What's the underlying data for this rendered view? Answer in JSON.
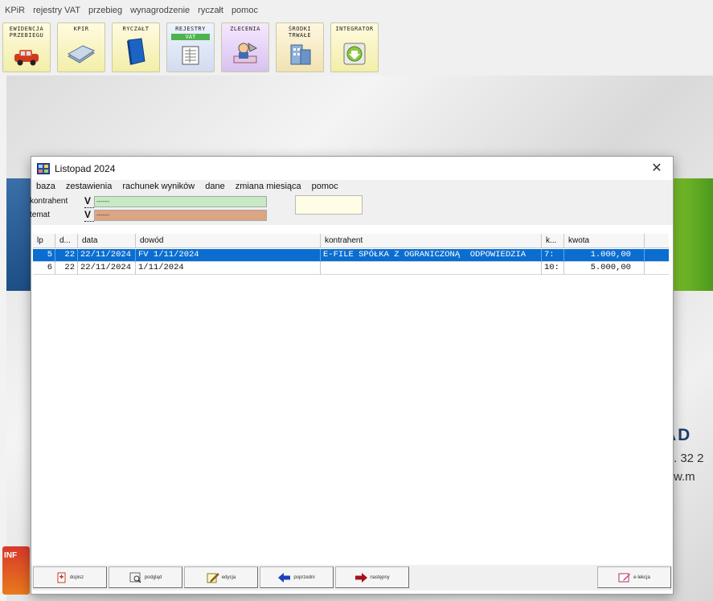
{
  "app_menu": [
    "KPiR",
    "rejestry VAT",
    "przebieg",
    "wynagrodzenie",
    "ryczałt",
    "pomoc"
  ],
  "toolbar": [
    {
      "label": "EWIDENCJA\nPRZEBIEGU",
      "icon": "car-icon"
    },
    {
      "label": "KPIR",
      "icon": "book-stack-icon"
    },
    {
      "label": "RYCZAŁT",
      "icon": "blue-book-icon"
    },
    {
      "label": "REJESTRY",
      "sublabel": "VAT",
      "icon": "register-sheet-icon"
    },
    {
      "label": "ZLECENIA",
      "icon": "contractor-icon"
    },
    {
      "label": "ŚRODKI\nTRWAŁE",
      "icon": "fixed-assets-icon"
    },
    {
      "label": "INTEGRATOR",
      "icon": "integrator-download-icon"
    }
  ],
  "background": {
    "brand": "AD",
    "tel": ". 32 2",
    "www": "w.m"
  },
  "info_tile": {
    "label": "INF"
  },
  "dialog": {
    "title": "Listopad  2024",
    "menu": [
      "baza",
      "zestawienia",
      "rachunek wyników",
      "dane",
      "zmiana miesiąca",
      "pomoc"
    ],
    "filters": {
      "kontrahent_label": "kontrahent",
      "kontrahent_value": "------",
      "temat_label": "temat",
      "temat_value": "------",
      "check_glyph": "V"
    },
    "columns": [
      "lp",
      "d...",
      "data",
      "dowód",
      "kontrahent",
      "k...",
      "kwota"
    ],
    "rows": [
      {
        "lp": "5",
        "d": "22",
        "data": "22/11/2024",
        "dowod": "FV 1/11/2024",
        "kontrahent": "E-FILE SPÓŁKA Z OGRANICZONĄ  ODPOWIEDZIA",
        "k": "7:",
        "kwota": "1.000,00",
        "selected": true
      },
      {
        "lp": "6",
        "d": "22",
        "data": "22/11/2024",
        "dowod": "1/11/2024",
        "kontrahent": "",
        "k": "10:",
        "kwota": "5.000,00",
        "selected": false
      }
    ],
    "buttons": {
      "dopisz": "dopisz",
      "podglad": "podgląd",
      "edycja": "edycja",
      "poprzedni": "poprzedni",
      "nastepny": "następny",
      "elekcja": "e-lekcja"
    }
  },
  "colors": {
    "selection": "#0a6ed1",
    "filter_green": "#c6ebc4",
    "filter_brown": "#dca583"
  }
}
